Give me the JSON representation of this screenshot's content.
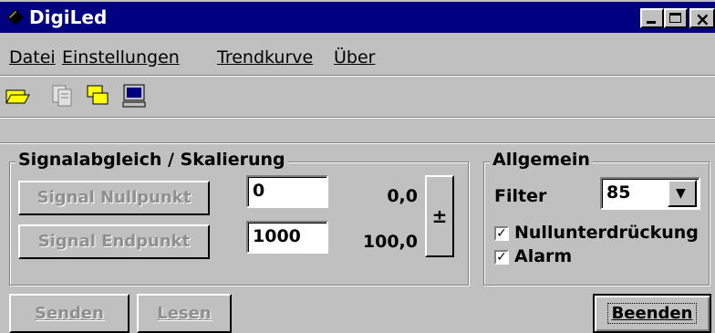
{
  "window": {
    "title": "DigiLed"
  },
  "menu": [
    "Datei",
    "Einstellungen",
    "Trendkurve",
    "Über"
  ],
  "toolbar": {
    "icons": [
      "open-folder-icon",
      "document-icon",
      "copy-folder-icon",
      "monitor-icon"
    ]
  },
  "signal": {
    "legend": "Signalabgleich / Skalierung",
    "null_button": "Signal Nullpunkt",
    "end_button": "Signal Endpunkt",
    "null_input": "0",
    "end_input": "1000",
    "null_value": "0,0",
    "end_value": "100,0",
    "plusminus": "±"
  },
  "general": {
    "legend": "Allgemein",
    "filter_label": "Filter",
    "filter_value": "85",
    "check1_label": "Nullunterdrückung",
    "check2_label": "Alarm"
  },
  "buttons": {
    "send": "Senden",
    "read": "Lesen",
    "close": "Beenden"
  }
}
